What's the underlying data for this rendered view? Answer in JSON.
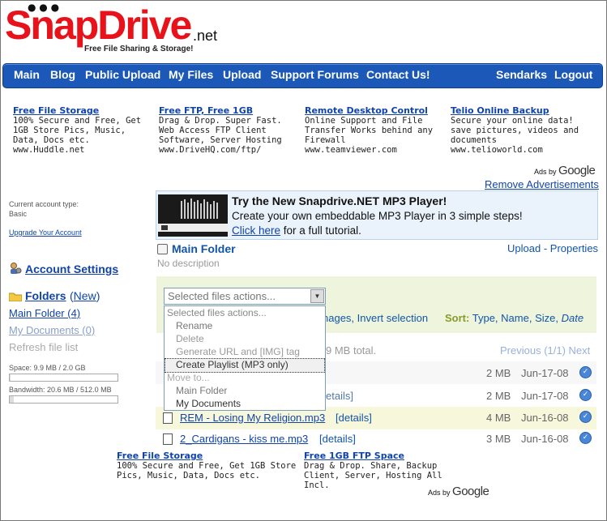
{
  "logo": {
    "brand": "SnapDrive",
    "suffix": ".net",
    "tagline": "Free File Sharing & Storage!"
  },
  "nav": {
    "left": [
      "Main",
      "Blog",
      "Public Upload",
      "My Files",
      "Upload",
      "Support Forums",
      "Contact Us!"
    ],
    "right": [
      "Sendarks",
      "Logout"
    ]
  },
  "ads_top": [
    {
      "title": "Free File Storage",
      "body": "100% Secure and Free, Get 1GB Store Pics, Music, Data, Docs etc.",
      "url": "www.Huddle.net"
    },
    {
      "title": "Free FTP, Free 1GB",
      "body": "Drag & Drop. Super Fast. Web Access FTP Client Software, Server Hosting",
      "url": "www.DriveHQ.com/ftp/"
    },
    {
      "title": "Remote Desktop Control",
      "body": "Online Support and File Transfer Works behind any Firewall",
      "url": "www.teamviewer.com"
    },
    {
      "title": "Telio Online Backup",
      "body": "Secure your online data! save pictures, videos and documents",
      "url": "www.telioworld.com"
    }
  ],
  "ads_by": {
    "prefix": "Ads by",
    "brand": "Google"
  },
  "remove_ads": "Remove Advertisements",
  "sidebar": {
    "account_type_label": "Current account type:",
    "account_type": "Basic",
    "upgrade": "Upgrade Your Account",
    "account_settings": "Account Settings",
    "folders": "Folders",
    "new": "New",
    "main_folder": "Main Folder (4)",
    "my_documents": "My Documents (0)",
    "refresh": "Refresh file list",
    "space_label": "Space: 9.9 MB / 2.0 GB",
    "space_fraction": 0.005,
    "bandwidth_label": "Bandwidth: 20.6 MB / 512.0 MB",
    "bandwidth_fraction": 0.04
  },
  "mp3_banner": {
    "heading": "Try the New Snapdrive.NET MP3 Player!",
    "line1": "Create your own embeddable MP3 Player in 3 simple steps!",
    "click_here": "Click here",
    "line2_rest": " for a full tutorial."
  },
  "folder": {
    "title": "Main Folder",
    "description": "No description",
    "upload": "Upload",
    "sep": "-",
    "properties": "Properties"
  },
  "toolbar": {
    "actions_placeholder": "Selected files actions...",
    "images_text": "nages, Invert selection",
    "sort_label": "Sort:",
    "sort_options": [
      "Type",
      "Name",
      "Size",
      "Date"
    ]
  },
  "dropdown_options": [
    "Selected files actions...",
    "Rename",
    "Delete",
    "Generate URL and [IMG] tag",
    "Create Playlist (MP3 only)",
    "Move to...",
    "Main Folder",
    "My Documents"
  ],
  "summary": {
    "total_text": "9 MB total.",
    "previous": "Previous (1/1)",
    "next": "Next"
  },
  "files": [
    {
      "name": "",
      "details": "",
      "size": "2 MB",
      "date": "Jun-17-08"
    },
    {
      "name": "",
      "details": "etails]",
      "size": "2 MB",
      "date": "Jun-17-08"
    },
    {
      "name": "REM - Losing My Religion.mp3",
      "details": "[details]",
      "size": "4 MB",
      "date": "Jun-16-08"
    },
    {
      "name": "2_Cardigans - kiss me.mp3",
      "details": "[details]",
      "size": "3 MB",
      "date": "Jun-16-08"
    }
  ],
  "ads_bottom": [
    {
      "title": "Free File Storage",
      "body": "100% Secure and Free, Get 1GB Store Pics, Music, Data, Docs etc."
    },
    {
      "title": "Free 1GB FTP Space",
      "body": "Drag & Drop. Share, Backup Client, Server, Hosting All Incl."
    }
  ]
}
